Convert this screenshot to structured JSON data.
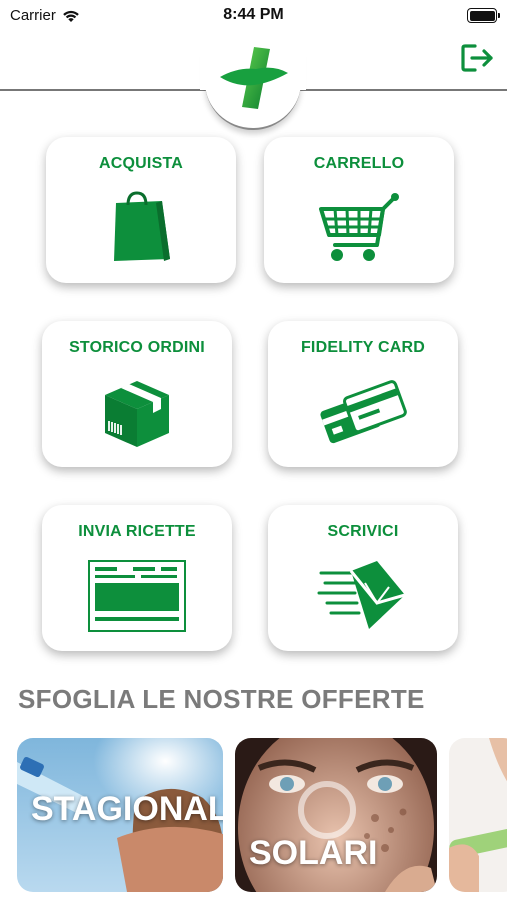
{
  "status_bar": {
    "carrier": "Carrier",
    "time": "8:44 PM"
  },
  "colors": {
    "brand_green": "#0d8f3c",
    "section_gray": "#7b7b7b"
  },
  "header": {
    "logo_icon": "pharmacy-cross-logo",
    "logout_icon": "logout-icon"
  },
  "menu": {
    "acquista": "ACQUISTA",
    "carrello": "CARRELLO",
    "storico_ordini": "STORICO ORDINI",
    "fidelity_card": "FIDELITY CARD",
    "invia_ricette": "INVIA RICETTE",
    "scrivici": "SCRIVICI"
  },
  "offers": {
    "section_title": "SFOGLIA LE NOSTRE OFFERTE",
    "items": [
      {
        "title": "STAGIONALI"
      },
      {
        "title": "SOLARI"
      }
    ]
  }
}
